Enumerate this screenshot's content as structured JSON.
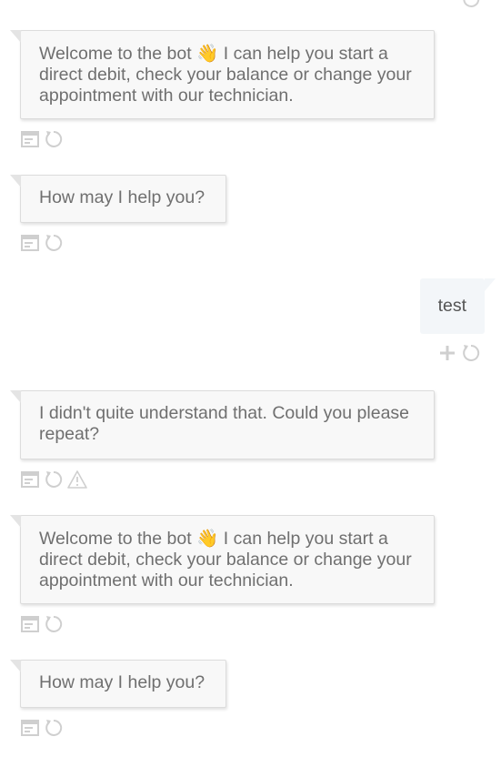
{
  "messages": [
    {
      "sender": "bot",
      "text_before_emoji": "Welcome to the bot ",
      "emoji": "👋",
      "text_after_emoji": " I can help you start a direct debit, check your balance or change your appointment with our technician."
    },
    {
      "sender": "bot",
      "text": "How may I help you?"
    },
    {
      "sender": "user",
      "text": "test"
    },
    {
      "sender": "bot",
      "text": "I didn't quite understand that. Could you please repeat?"
    },
    {
      "sender": "bot",
      "text_before_emoji": "Welcome to the bot ",
      "emoji": "👋",
      "text_after_emoji": " I can help you start a direct debit, check your balance or change your appointment with our technician."
    },
    {
      "sender": "bot",
      "text": "How may I help you?"
    }
  ],
  "icons": {
    "details": "details-icon",
    "restart": "restart-icon",
    "warning": "warning-icon",
    "add": "add-icon"
  },
  "colors": {
    "bot_bubble_bg": "#f8f8f8",
    "bot_bubble_border": "#dcdcdc",
    "user_bubble_bg": "#f3f6f9",
    "icon_color": "#cfcfcf",
    "text_color": "#6f6f6f"
  }
}
